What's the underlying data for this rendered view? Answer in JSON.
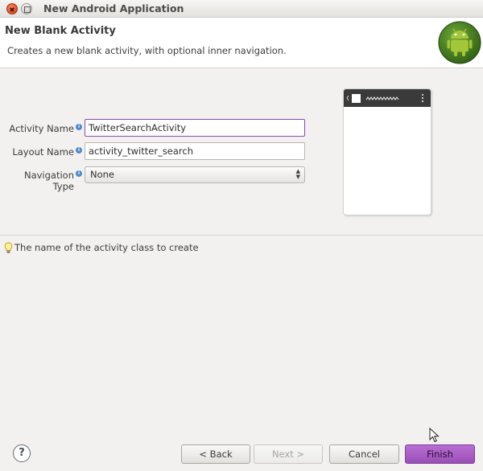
{
  "window": {
    "title": "New Android Application"
  },
  "header": {
    "title": "New Blank Activity",
    "description": "Creates a new blank activity, with optional inner navigation."
  },
  "form": {
    "activity_name": {
      "label": "Activity Name",
      "value": "TwitterSearchActivity"
    },
    "layout_name": {
      "label": "Layout Name",
      "value": "activity_twitter_search"
    },
    "navigation_type": {
      "label": "Navigation Type",
      "selected": "None"
    }
  },
  "status": {
    "message": "The name of the activity class to create"
  },
  "buttons": {
    "back": "< Back",
    "next": "Next >",
    "cancel": "Cancel",
    "finish": "Finish",
    "help": "?"
  },
  "colors": {
    "accent": "#9a4fb7",
    "focus_border": "#8a4aa8",
    "android_green": "#97c024"
  }
}
